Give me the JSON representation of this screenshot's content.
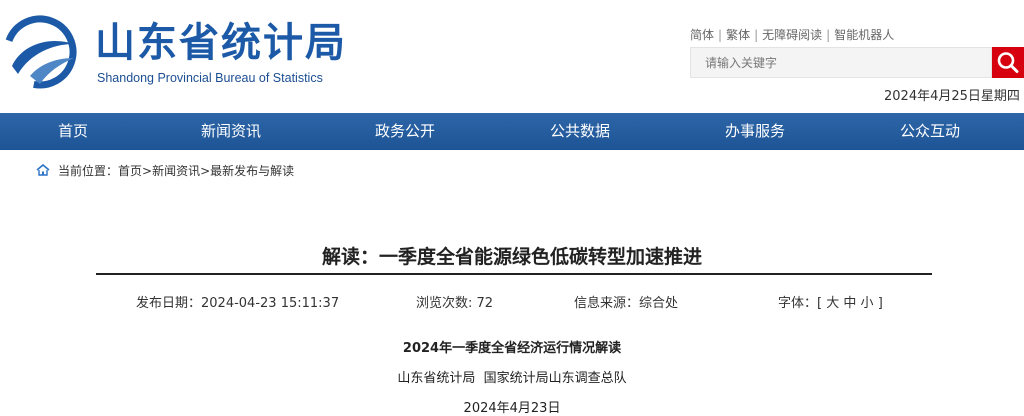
{
  "header": {
    "logo_cn": "山东省统计局",
    "logo_en": "Shandong Provincial Bureau of Statistics",
    "quick_links": [
      "简体",
      "繁体",
      "无障碍阅读",
      "智能机器人"
    ],
    "quick_links_separator": "|",
    "search_placeholder": "请输入关键字",
    "date": "2024年4月25日星期四"
  },
  "nav": [
    "首页",
    "新闻资讯",
    "政务公开",
    "公共数据",
    "办事服务",
    "公众互动"
  ],
  "breadcrumb": {
    "prefix": "当前位置：",
    "path": "首页>新闻资讯>最新发布与解读"
  },
  "article": {
    "title": "解读：一季度全省能源绿色低碳转型加速推进",
    "publish_label": "发布日期：",
    "publish_value": "2024-04-23 15:11:37",
    "views_label": "浏览次数: ",
    "views_value": "72",
    "source_label": "信息来源：",
    "source_value": "综合处",
    "font_label": "字体：[",
    "font_large": "大",
    "font_medium": "中",
    "font_small": "小",
    "font_close": "]",
    "subheading": "2024年一季度全省经济运行情况解读",
    "authors": "山东省统计局  国家统计局山东调查总队",
    "date": "2024年4月23日"
  },
  "colors": {
    "brand_blue": "#1c5aa7",
    "nav_blue": "#1d5496",
    "search_red": "#d7000f"
  }
}
